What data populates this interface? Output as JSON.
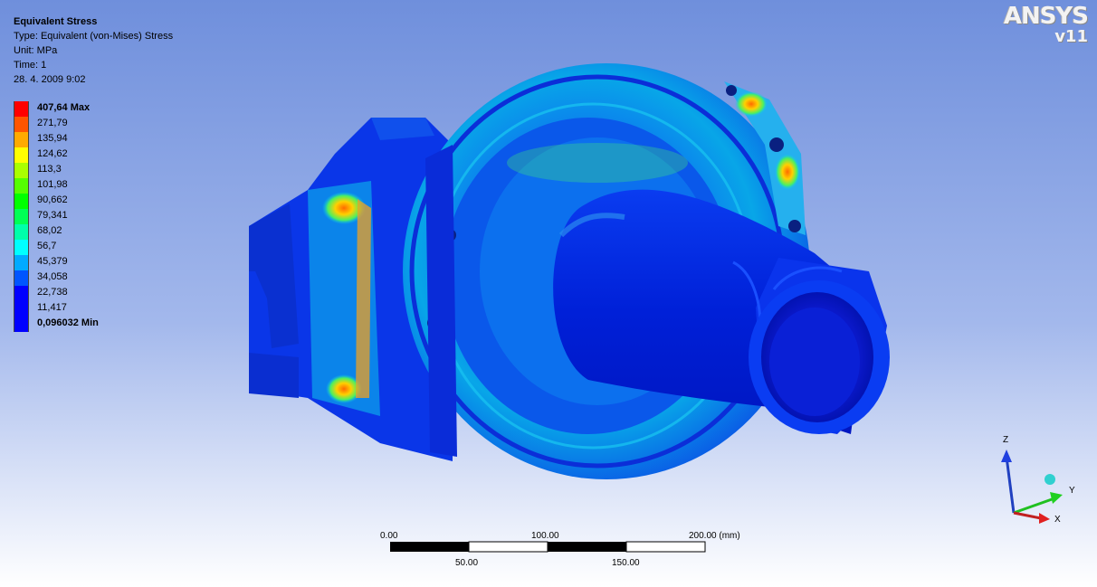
{
  "result_info": {
    "title": "Equivalent Stress",
    "type": "Type: Equivalent (von-Mises) Stress",
    "unit": "Unit: MPa",
    "time": "Time: 1",
    "date": "28. 4. 2009 9:02"
  },
  "legend": {
    "entries": [
      {
        "label": "407,64 Max",
        "color": "#ff0000",
        "bold": true
      },
      {
        "label": "271,79",
        "color": "#ff5500",
        "bold": false
      },
      {
        "label": "135,94",
        "color": "#ffaa00",
        "bold": false
      },
      {
        "label": "124,62",
        "color": "#ffff00",
        "bold": false
      },
      {
        "label": "113,3",
        "color": "#aaff00",
        "bold": false
      },
      {
        "label": "101,98",
        "color": "#55ff00",
        "bold": false
      },
      {
        "label": "90,662",
        "color": "#00ff00",
        "bold": false
      },
      {
        "label": "79,341",
        "color": "#00ff55",
        "bold": false
      },
      {
        "label": "68,02",
        "color": "#00ffaa",
        "bold": false
      },
      {
        "label": "56,7",
        "color": "#00ffff",
        "bold": false
      },
      {
        "label": "45,379",
        "color": "#00aaff",
        "bold": false
      },
      {
        "label": "34,058",
        "color": "#0055ff",
        "bold": false
      },
      {
        "label": "22,738",
        "color": "#0000ff",
        "bold": false
      },
      {
        "label": "11,417",
        "color": "#0000ff",
        "bold": false
      },
      {
        "label": "0,096032 Min",
        "color": "#0000ff",
        "bold": true
      }
    ]
  },
  "logo": {
    "brand": "ANSYS",
    "version": "v11"
  },
  "scale_bar": {
    "top_labels": [
      "0.00",
      "100.00",
      "200.00 (mm)"
    ],
    "bottom_labels": [
      "50.00",
      "150.00"
    ]
  },
  "triad": {
    "z": "Z",
    "y": "Y",
    "x": "X"
  }
}
